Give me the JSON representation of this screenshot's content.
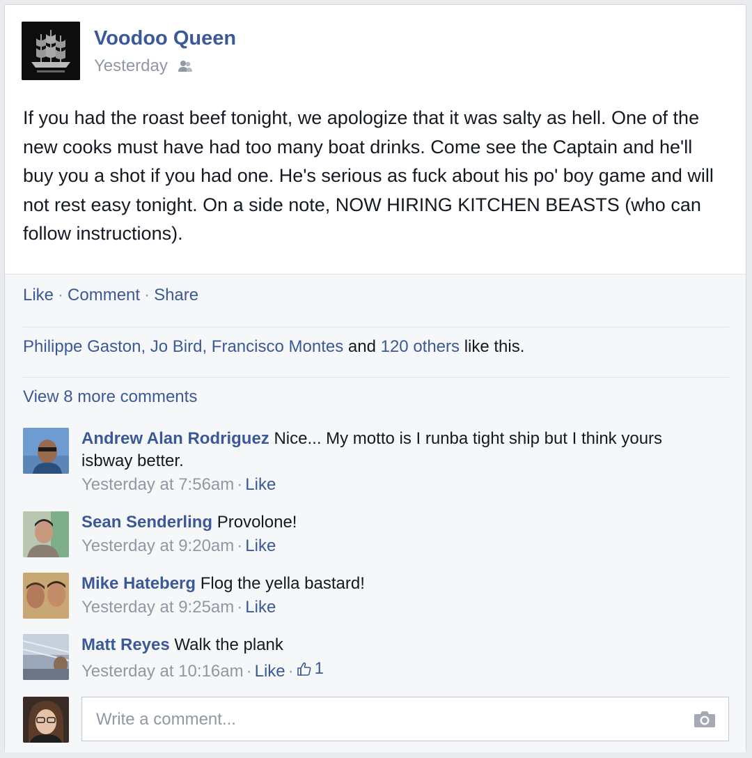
{
  "post": {
    "page_name": "Voodoo Queen",
    "timestamp": "Yesterday",
    "audience_icon": "friends-icon",
    "text": "If you had the roast beef tonight, we apologize that it was salty as hell. One of the new cooks must have had too many boat drinks. Come see the Captain and he'll buy you a shot if you had one. He's serious as fuck about his po' boy game and will not rest easy tonight. On a side note, NOW HIRING KITCHEN BEASTS (who can follow instructions)."
  },
  "actions": {
    "like": "Like",
    "comment": "Comment",
    "share": "Share",
    "separator": "·"
  },
  "likes_summary": {
    "names": "Philippe Gaston, Jo Bird, Francisco Montes",
    "joiner": " and ",
    "others": "120 others",
    "suffix": " like this."
  },
  "view_more_comments": "View 8 more comments",
  "comments": [
    {
      "author": "Andrew Alan Rodriguez",
      "text": " Nice... My motto is I runba tight ship but I think yours isbway better.",
      "time": "Yesterday at 7:56am",
      "like_label": "Like"
    },
    {
      "author": "Sean Senderling",
      "text": " Provolone!",
      "time": "Yesterday at 9:20am",
      "like_label": "Like"
    },
    {
      "author": "Mike Hateberg",
      "text": " Flog the yella bastard!",
      "time": "Yesterday at 9:25am",
      "like_label": "Like"
    },
    {
      "author": "Matt Reyes",
      "text": " Walk the plank",
      "time": "Yesterday at 10:16am",
      "like_label": "Like",
      "like_count": "1"
    }
  ],
  "composer": {
    "placeholder": "Write a comment...",
    "icon": "camera-icon"
  },
  "colors": {
    "link_blue": "#3b5998",
    "meta_gray": "#9197a3",
    "footer_bg": "#f6f7f8"
  }
}
